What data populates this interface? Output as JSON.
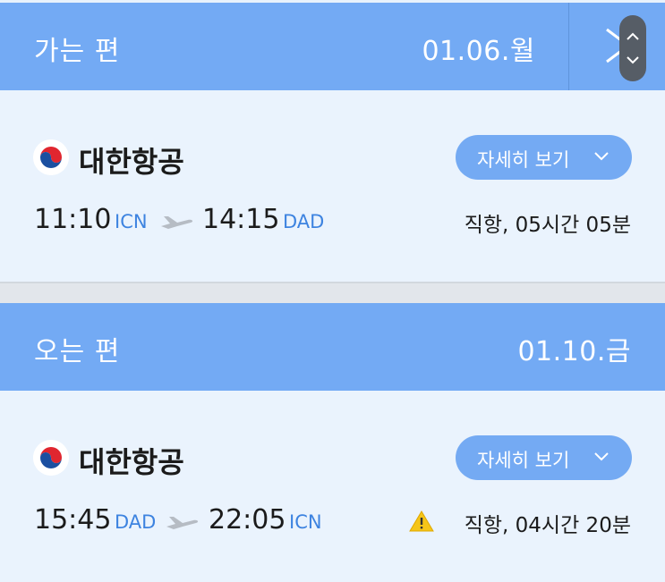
{
  "outbound": {
    "header": {
      "label": "가는 편",
      "date": "01.06.월"
    },
    "airline": {
      "name": "대한항공",
      "logo_icon": "korean-air-taegeuk-logo"
    },
    "details_button": "자세히 보기",
    "departure": {
      "time": "11:10",
      "code": "ICN"
    },
    "arrival": {
      "time": "14:15",
      "code": "DAD"
    },
    "duration": "직항, 05시간 05분"
  },
  "return": {
    "header": {
      "label": "오는 편",
      "date": "01.10.금"
    },
    "airline": {
      "name": "대한항공",
      "logo_icon": "korean-air-taegeuk-logo"
    },
    "details_button": "자세히 보기",
    "departure": {
      "time": "15:45",
      "code": "DAD"
    },
    "arrival": {
      "time": "22:05",
      "code": "ICN"
    },
    "duration": "직항, 04시간 20분",
    "warning_icon": "warning-triangle-icon"
  },
  "colors": {
    "header_bg": "#73aaf4",
    "card_bg": "#eaf3fd",
    "airport_code": "#3d83e0",
    "button_bg": "#74aaf3",
    "warning": "#f5c518"
  }
}
